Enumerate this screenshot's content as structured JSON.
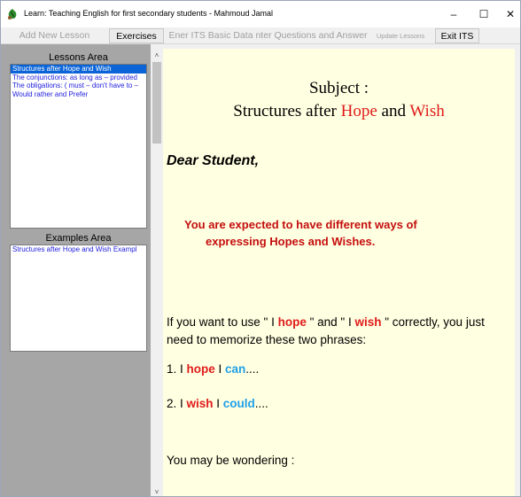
{
  "window": {
    "title": "Learn: Teaching English for first secondary students  - Mahmoud Jamal",
    "controls": {
      "minimize": "–",
      "maximize": "☐",
      "close": "✕"
    }
  },
  "toolbar": {
    "buttons": [
      {
        "label": "Add New Lesson",
        "enabled": false
      },
      {
        "label": "Exercises",
        "enabled": true
      },
      {
        "label": "Ener ITS Basic Data",
        "enabled": false
      },
      {
        "label": "nter Questions and Answer",
        "enabled": false
      },
      {
        "label": "Update Lessons",
        "enabled": false
      },
      {
        "label": "Exit ITS",
        "enabled": true
      }
    ]
  },
  "lessons_area": {
    "label": "Lessons Area",
    "items": [
      {
        "text": "Structures after Hope and Wish",
        "selected": true
      },
      {
        "text": "The conjunctions: as long as – provided",
        "selected": false
      },
      {
        "text": "The obligations: ( must – don't have to –",
        "selected": false
      },
      {
        "text": "Would rather and Prefer",
        "selected": false
      }
    ]
  },
  "examples_area": {
    "label": "Examples Area",
    "items": [
      {
        "text": "Structures after Hope and Wish Exampl"
      }
    ]
  },
  "scrollbar": {
    "up": "˄",
    "down": "˅"
  },
  "content": {
    "subject_label": "Subject :",
    "subject_title": {
      "part1": "Structures",
      "part2": " after ",
      "hope": "Hope",
      "and": " and ",
      "wish": "Wish"
    },
    "greeting": "Dear Student,",
    "expect_line1": "You are expected to have different ways of",
    "expect_line2": "expressing Hopes and Wishes.",
    "intro": {
      "t1": "If you want to use \" I ",
      "hope": "hope",
      "t2": " \" and \" I ",
      "wish": "wish",
      "t3": " \" correctly, you just",
      "line2": "need to memorize these two phrases:"
    },
    "phrase1": {
      "num": "1. I ",
      "kw1": "hope",
      "mid": " I ",
      "kw2": "can",
      "end": "...."
    },
    "phrase2": {
      "num": "2. I ",
      "kw1": "wish",
      "mid": " I ",
      "kw2": "could",
      "end": "...."
    },
    "wondering": "You may be wondering :"
  },
  "colors": {
    "content_bg": "#ffffe1",
    "keyword_red": "#e01b1b",
    "keyword_blue": "#1fa0e8",
    "selection_blue": "#0a64d8",
    "panel_gray": "#a6a6a6"
  }
}
